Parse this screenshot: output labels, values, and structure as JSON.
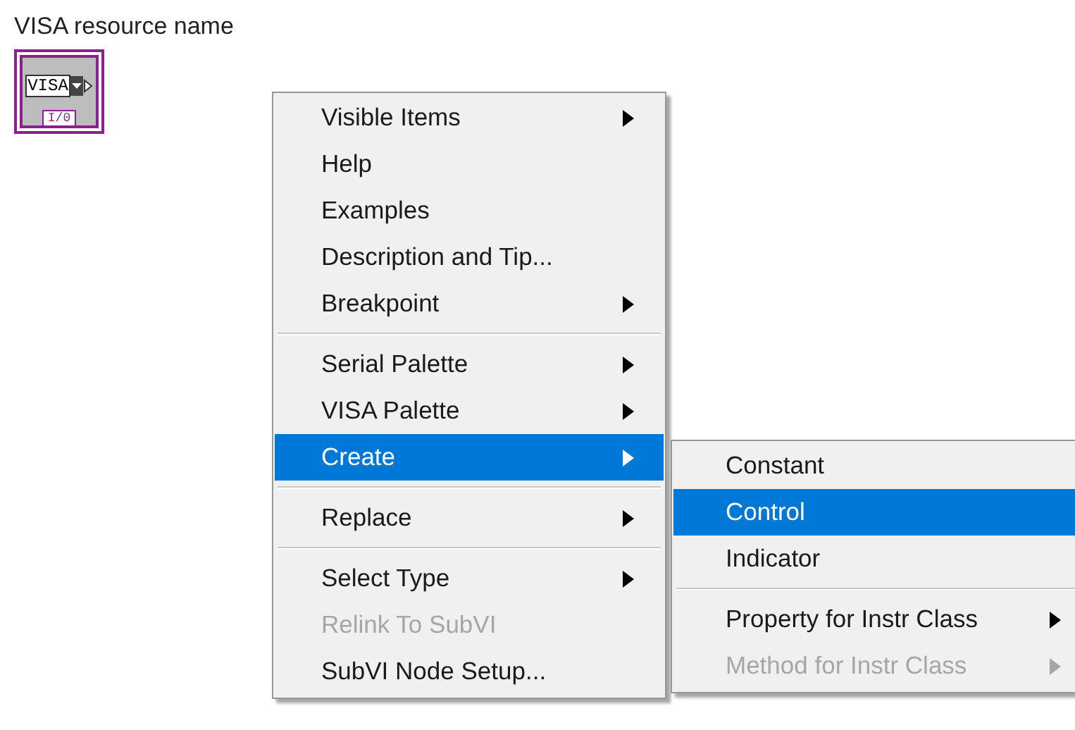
{
  "terminal": {
    "label": "VISA resource name",
    "text": "VISA",
    "tag": "I/0"
  },
  "menu": {
    "items": [
      {
        "kind": "item",
        "label": "Visible Items",
        "submenu": true,
        "selected": false,
        "disabled": false
      },
      {
        "kind": "item",
        "label": "Help",
        "submenu": false,
        "selected": false,
        "disabled": false
      },
      {
        "kind": "item",
        "label": "Examples",
        "submenu": false,
        "selected": false,
        "disabled": false
      },
      {
        "kind": "item",
        "label": "Description and Tip...",
        "submenu": false,
        "selected": false,
        "disabled": false
      },
      {
        "kind": "item",
        "label": "Breakpoint",
        "submenu": true,
        "selected": false,
        "disabled": false
      },
      {
        "kind": "separator"
      },
      {
        "kind": "item",
        "label": "Serial Palette",
        "submenu": true,
        "selected": false,
        "disabled": false
      },
      {
        "kind": "item",
        "label": "VISA Palette",
        "submenu": true,
        "selected": false,
        "disabled": false
      },
      {
        "kind": "item",
        "label": "Create",
        "submenu": true,
        "selected": true,
        "disabled": false
      },
      {
        "kind": "separator"
      },
      {
        "kind": "item",
        "label": "Replace",
        "submenu": true,
        "selected": false,
        "disabled": false
      },
      {
        "kind": "separator"
      },
      {
        "kind": "item",
        "label": "Select Type",
        "submenu": true,
        "selected": false,
        "disabled": false
      },
      {
        "kind": "item",
        "label": "Relink To SubVI",
        "submenu": false,
        "selected": false,
        "disabled": true
      },
      {
        "kind": "item",
        "label": "SubVI Node Setup...",
        "submenu": false,
        "selected": false,
        "disabled": false
      }
    ]
  },
  "submenu": {
    "items": [
      {
        "kind": "item",
        "label": "Constant",
        "submenu": false,
        "selected": false,
        "disabled": false
      },
      {
        "kind": "item",
        "label": "Control",
        "submenu": false,
        "selected": true,
        "disabled": false
      },
      {
        "kind": "item",
        "label": "Indicator",
        "submenu": false,
        "selected": false,
        "disabled": false
      },
      {
        "kind": "separator"
      },
      {
        "kind": "item",
        "label": "Property for Instr Class",
        "submenu": true,
        "selected": false,
        "disabled": false
      },
      {
        "kind": "item",
        "label": "Method for Instr Class",
        "submenu": true,
        "selected": false,
        "disabled": true
      }
    ]
  }
}
